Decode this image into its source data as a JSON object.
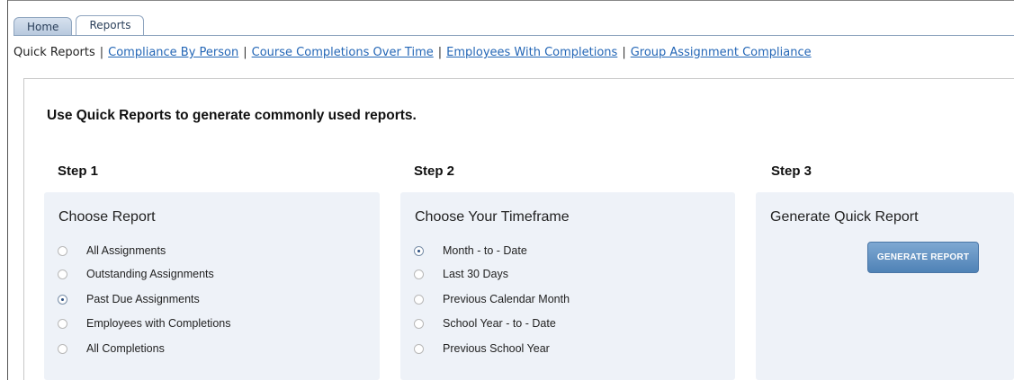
{
  "tabs": [
    {
      "label": "Home",
      "active": false
    },
    {
      "label": "Reports",
      "active": true
    }
  ],
  "subnav": {
    "current": "Quick Reports",
    "links": [
      "Compliance By Person",
      "Course Completions Over Time",
      "Employees With Completions",
      "Group Assignment Compliance"
    ],
    "separator": "|"
  },
  "intro": "Use Quick Reports to generate commonly used reports.",
  "steps": [
    {
      "title": "Step 1",
      "heading": "Choose Report",
      "options": [
        {
          "label": "All Assignments",
          "selected": false
        },
        {
          "label": "Outstanding Assignments",
          "selected": false
        },
        {
          "label": "Past Due Assignments",
          "selected": true
        },
        {
          "label": "Employees with Completions",
          "selected": false
        },
        {
          "label": "All Completions",
          "selected": false
        }
      ]
    },
    {
      "title": "Step 2",
      "heading": "Choose Your Timeframe",
      "options": [
        {
          "label": "Month - to - Date",
          "selected": true
        },
        {
          "label": "Last 30 Days",
          "selected": false
        },
        {
          "label": "Previous Calendar Month",
          "selected": false
        },
        {
          "label": "School Year - to - Date",
          "selected": false
        },
        {
          "label": "Previous School Year",
          "selected": false
        }
      ]
    },
    {
      "title": "Step 3",
      "heading": "Generate Quick Report",
      "button_label": "GENERATE REPORT"
    }
  ],
  "colors": {
    "link": "#2366b6",
    "box_background": "#eef2f8",
    "button": "#5b8dc0"
  }
}
